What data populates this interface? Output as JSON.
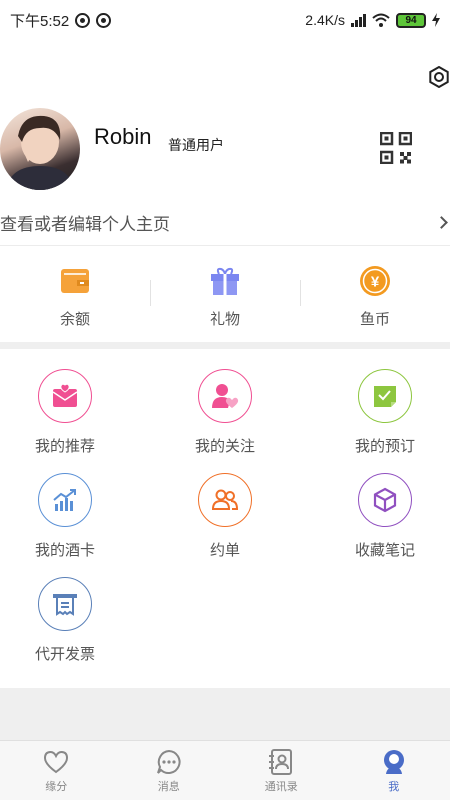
{
  "status_bar": {
    "time": "下午5:52",
    "speed": "2.4K/s",
    "battery": "94"
  },
  "profile": {
    "name": "Robin",
    "role": "普通用户",
    "link_text": "查看或者编辑个人主页"
  },
  "wallet": {
    "items": [
      {
        "label": "余额",
        "icon": "wallet-icon",
        "color": "#f5a23a"
      },
      {
        "label": "礼物",
        "icon": "gift-icon",
        "color": "#7b86f0"
      },
      {
        "label": "鱼币",
        "icon": "yuan-coin-icon",
        "color": "#f39a20",
        "glyph": "¥"
      }
    ]
  },
  "menu": {
    "items": [
      {
        "label": "我的推荐",
        "icon": "recommend-envelope-icon",
        "color": "#f04f92"
      },
      {
        "label": "我的关注",
        "icon": "follow-user-heart-icon",
        "color": "#f04f92"
      },
      {
        "label": "我的预订",
        "icon": "booking-check-icon",
        "color": "#8dc63f"
      },
      {
        "label": "我的酒卡",
        "icon": "wine-card-chart-icon",
        "color": "#5a90d6"
      },
      {
        "label": "约单",
        "icon": "date-order-users-icon",
        "color": "#f07028"
      },
      {
        "label": "收藏笔记",
        "icon": "notes-cube-icon",
        "color": "#9050c0"
      },
      {
        "label": "代开发票",
        "icon": "invoice-icon",
        "color": "#5a80b8"
      }
    ]
  },
  "bottom_nav": {
    "items": [
      {
        "label": "缘分",
        "icon": "heart-icon"
      },
      {
        "label": "消息",
        "icon": "message-icon"
      },
      {
        "label": "通讯录",
        "icon": "contacts-icon"
      },
      {
        "label": "我",
        "icon": "me-icon",
        "active": true
      }
    ],
    "active_color": "#4a6cc7"
  }
}
